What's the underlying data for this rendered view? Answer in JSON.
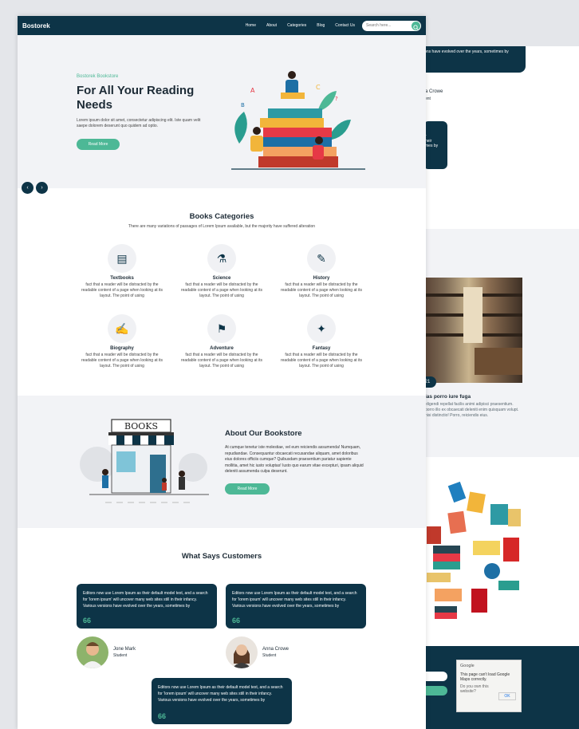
{
  "nav": {
    "brand": "Bostorek",
    "items": [
      "Home",
      "About",
      "Categories",
      "Blog",
      "Contact Us"
    ],
    "search_placeholder": "Search here..."
  },
  "hero": {
    "subtitle": "Bostorek Bookstore",
    "title": "For All Your Reading Needs",
    "text": "Lorem ipsum dolor sit amet, consectetur adipiscing elit. Iste quam velit saepe dolorem deserunt quo quidem ad optio.",
    "button": "Read More"
  },
  "categories": {
    "title": "Books Categories",
    "subtitle": "There are many variations of passages of Lorem Ipsum available, but the majority have suffered alteration",
    "items": [
      {
        "name": "Textbooks",
        "icon": "textbook-icon",
        "text": "fact that a reader will be distracted by the readable content of a page when looking at its layout. The point of using"
      },
      {
        "name": "Science",
        "icon": "science-icon",
        "text": "fact that a reader will be distracted by the readable content of a page when looking at its layout. The point of using"
      },
      {
        "name": "History",
        "icon": "history-icon",
        "text": "fact that a reader will be distracted by the readable content of a page when looking at its layout. The point of using"
      },
      {
        "name": "Biography",
        "icon": "biography-icon",
        "text": "fact that a reader will be distracted by the readable content of a page when looking at its layout. The point of using"
      },
      {
        "name": "Adventure",
        "icon": "adventure-icon",
        "text": "fact that a reader will be distracted by the readable content of a page when looking at its layout. The point of using"
      },
      {
        "name": "Fantasy",
        "icon": "fantasy-icon",
        "text": "fact that a reader will be distracted by the readable content of a page when looking at its layout. The point of using"
      }
    ]
  },
  "about": {
    "store_sign": "BOOKS",
    "title": "About Our Bookstore",
    "text": "At cumque tenetur iste molestiae, vel eum reiciendis assumenda! Numquam, repudiandae. Consequuntur obcaecati recusandae aliquam, amet doloribus eius dolores officiis cumque? Quibusdam praesentium pariatur sapiente mollitia, amet hic iusto voluptas! Iusto quo earum vitae excepturi, ipsam aliquid deleniti assumenda culpa deserunt.",
    "button": "Read More"
  },
  "customers": {
    "title": "What Says Customers",
    "testimonials": [
      {
        "text": "Editors now use Lorem Ipsum as their default model text, and a search for 'lorem ipsum' will uncover many web sites still in their infancy. Various versions have evolved over the years, sometimes by",
        "name": "Jone Mark",
        "role": "Student"
      },
      {
        "text": "Editors now use Lorem Ipsum as their default model text, and a search for 'lorem ipsum' will uncover many web sites still in their infancy. Various versions have evolved over the years, sometimes by",
        "name": "Anna Crowe",
        "role": "Student"
      },
      {
        "text": "Editors now use Lorem Ipsum as their default model text, and a search for 'lorem ipsum' will uncover many web sites still in their infancy. Various versions have evolved over the years, sometimes by"
      }
    ],
    "quote_mark": "66"
  },
  "back_page": {
    "testimonial_fragment": "ions have evolved over the years, sometimes by",
    "name_fragment": "a Crowe",
    "role_fragment": "ent",
    "box_fragment": "r\nheir\nmes by",
    "blog_badge": "21",
    "blog_title": "ias porro iure fuga",
    "blog_text": "eligendi repellat facilis animi adipisci praesentium. porro illo ex obcaecati deleniti enim quisquam volupt. nisi distinctio! Porro, reiciendis eius.",
    "map_title": "Google",
    "map_message": "This page can't load Google Maps correctly.",
    "map_question": "Do you own this website?",
    "map_ok": "OK"
  },
  "colors": {
    "primary": "#0d3447",
    "accent": "#4db896",
    "light_bg": "#f2f3f6"
  }
}
